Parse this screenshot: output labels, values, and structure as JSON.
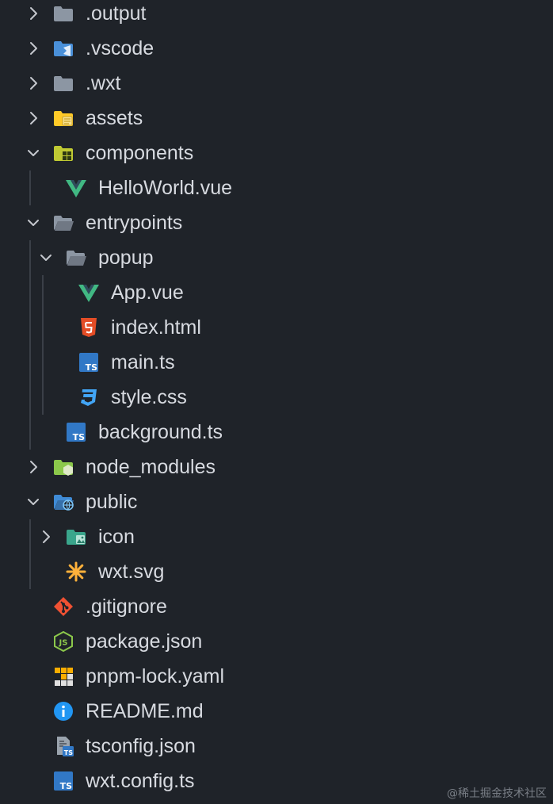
{
  "explorer": {
    "items": [
      {
        "name": ".output",
        "depth": 0,
        "kind": "folder",
        "expanded": false,
        "icon": "folder-icon"
      },
      {
        "name": ".vscode",
        "depth": 0,
        "kind": "folder",
        "expanded": false,
        "icon": "vscode-folder-icon"
      },
      {
        "name": ".wxt",
        "depth": 0,
        "kind": "folder",
        "expanded": false,
        "icon": "folder-icon"
      },
      {
        "name": "assets",
        "depth": 0,
        "kind": "folder",
        "expanded": false,
        "icon": "assets-folder-icon"
      },
      {
        "name": "components",
        "depth": 0,
        "kind": "folder",
        "expanded": true,
        "icon": "components-folder-icon"
      },
      {
        "name": "HelloWorld.vue",
        "depth": 1,
        "kind": "file",
        "icon": "vue-icon"
      },
      {
        "name": "entrypoints",
        "depth": 0,
        "kind": "folder",
        "expanded": true,
        "icon": "folder-open-icon"
      },
      {
        "name": "popup",
        "depth": 1,
        "kind": "folder",
        "expanded": true,
        "icon": "folder-open-icon"
      },
      {
        "name": "App.vue",
        "depth": 2,
        "kind": "file",
        "icon": "vue-icon"
      },
      {
        "name": "index.html",
        "depth": 2,
        "kind": "file",
        "icon": "html5-icon"
      },
      {
        "name": "main.ts",
        "depth": 2,
        "kind": "file",
        "icon": "typescript-icon"
      },
      {
        "name": "style.css",
        "depth": 2,
        "kind": "file",
        "icon": "css3-icon"
      },
      {
        "name": "background.ts",
        "depth": 1,
        "kind": "file",
        "icon": "typescript-icon"
      },
      {
        "name": "node_modules",
        "depth": 0,
        "kind": "folder",
        "expanded": false,
        "icon": "node-folder-icon"
      },
      {
        "name": "public",
        "depth": 0,
        "kind": "folder",
        "expanded": true,
        "icon": "public-folder-icon"
      },
      {
        "name": "icon",
        "depth": 1,
        "kind": "folder",
        "expanded": false,
        "icon": "images-folder-icon"
      },
      {
        "name": "wxt.svg",
        "depth": 1,
        "kind": "file",
        "icon": "svg-icon"
      },
      {
        "name": ".gitignore",
        "depth": 0,
        "kind": "file",
        "icon": "git-icon"
      },
      {
        "name": "package.json",
        "depth": 0,
        "kind": "file",
        "icon": "nodejs-icon"
      },
      {
        "name": "pnpm-lock.yaml",
        "depth": 0,
        "kind": "file",
        "icon": "pnpm-icon"
      },
      {
        "name": "README.md",
        "depth": 0,
        "kind": "file",
        "icon": "info-icon"
      },
      {
        "name": "tsconfig.json",
        "depth": 0,
        "kind": "file",
        "icon": "tsconfig-icon"
      },
      {
        "name": "wxt.config.ts",
        "depth": 0,
        "kind": "file",
        "icon": "typescript-icon"
      }
    ]
  },
  "watermark": "@稀土掘金技术社区",
  "colors": {
    "background": "#1f2329",
    "text": "#d7dae0",
    "chevron": "#c5c8ce",
    "guide": "#3a3f47",
    "folder": "#8c96a3",
    "vue": "#41b883",
    "html": "#e44d26",
    "typescript": "#3178c6",
    "css": "#42a5f5",
    "git": "#f05133",
    "node": "#8cc84b",
    "svg": "#ffb13b",
    "info": "#2196f3",
    "assets": "#ffca28"
  }
}
